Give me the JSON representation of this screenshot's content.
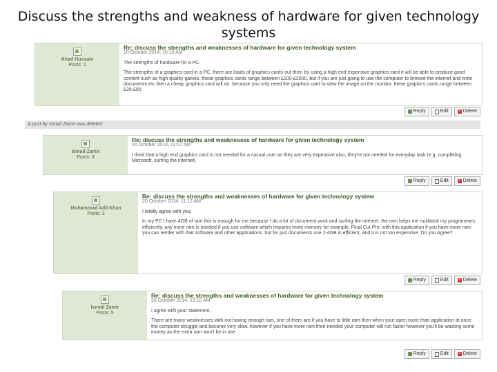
{
  "slide": {
    "title_line1": "Discuss the strengths and weakness of hardware for given technology",
    "title_line2": "systems"
  },
  "buttons": {
    "reply": "Reply",
    "edit": "Edit",
    "delete": "Delete"
  },
  "deleted_notice": "A post by Ismail Zamir was deleted",
  "posts": [
    {
      "author": "Ahad Hussain",
      "post_count": "Posts: 2",
      "subject": "Re: discuss the strengths and weaknesses of hardware for given technology system",
      "date": "20 October 2014, 10:10 AM",
      "paragraphs": [
        "The strengths of hardware for a PC.",
        "The strengths of a graphics card in a PC, there are loads of graphics cards out their, by using a high end expensive graphics card it will be able to produce good content such as high quality games. these graphics cards range between £100-£2000, but if you are just going to use the computer to browse the internet and write documents etc then a cheap graphics card will do. because you only need the graphics card to view the image on the monitor. these graphics cards range between £20-£90"
      ]
    },
    {
      "author": "Ismail Zamir",
      "post_count": "Posts: 3",
      "subject": "Re: discuss the strengths and weaknesses of hardware for given technology system",
      "date": "20 October 2014, 11:07 AM",
      "paragraphs": [
        "I think that a high end graphics card is not needed for a casual user as they are very expensive also, they're not needed for everyday task (e.g. completing Microsoft, surfing the internet)"
      ]
    },
    {
      "author": "Muhammad Adil Khan",
      "post_count": "Posts: 3",
      "subject": "Re: discuss the strengths and weaknesses of hardware for given technology system",
      "date": "20 October 2014, 11:12 AM",
      "paragraphs": [
        "I totally agree with you,",
        "In my PC I have 4GB of ram this is enough for me because I do a lot of document work and surfing the internet. the ram helps me multitask my programmes efficiently. any more ram is needed if you use software which requires more memory for example, Final Cut Pro. with this application if you have more ram you can render with that software and other applications. but for just documents use 2-4GB is efficient, and it is not too expensive. Do you Agree?"
      ]
    },
    {
      "author": "Ismail Zamir",
      "post_count": "Posts: 5",
      "subject": "Re: discuss the strengths and weaknesses of hardware for given technology system",
      "date": "20 October 2014, 12:10 AM",
      "paragraphs": [
        "I agree with your statement.",
        "There are many weaknesses with not having enough ram, one of them are if you have to little ram then when your open more than application at once the computer struggle and become very slow. however if you have more ram then needed your computer will run faster however you'll be wasting some money as the extra ram won't be in use"
      ]
    }
  ]
}
